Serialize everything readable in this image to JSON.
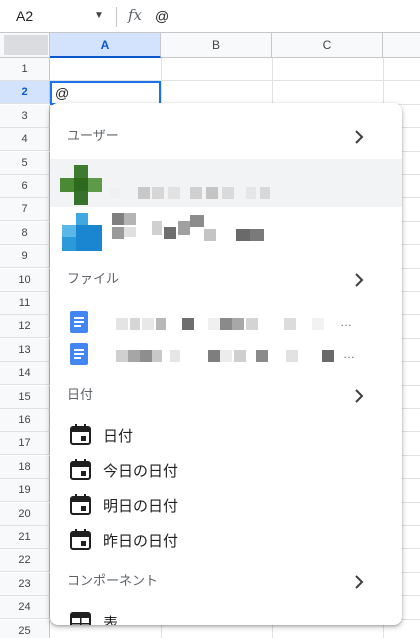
{
  "formula_bar": {
    "cell_ref": "A2",
    "fx_label": "fx",
    "value": "@"
  },
  "columns": [
    "A",
    "B",
    "C"
  ],
  "rows": [
    "1",
    "2",
    "3",
    "4",
    "5",
    "6",
    "7",
    "8",
    "9",
    "10",
    "11",
    "12",
    "13",
    "14",
    "15",
    "16",
    "17",
    "18",
    "19",
    "20",
    "21",
    "22",
    "23",
    "24",
    "25"
  ],
  "active_cell": {
    "ref": "A2",
    "value": "@"
  },
  "popup": {
    "sections": {
      "users": "ユーザー",
      "files": "ファイル",
      "dates": "日付",
      "components": "コンポーネント"
    },
    "date_items": [
      "日付",
      "今日の日付",
      "明日の日付",
      "昨日の日付"
    ],
    "component_items": [
      "表"
    ],
    "file_ellipsis": "…"
  },
  "colors": {
    "accent": "#1a73e8",
    "selected_header": "#d3e3fd",
    "doc_icon": "#4285f4"
  }
}
